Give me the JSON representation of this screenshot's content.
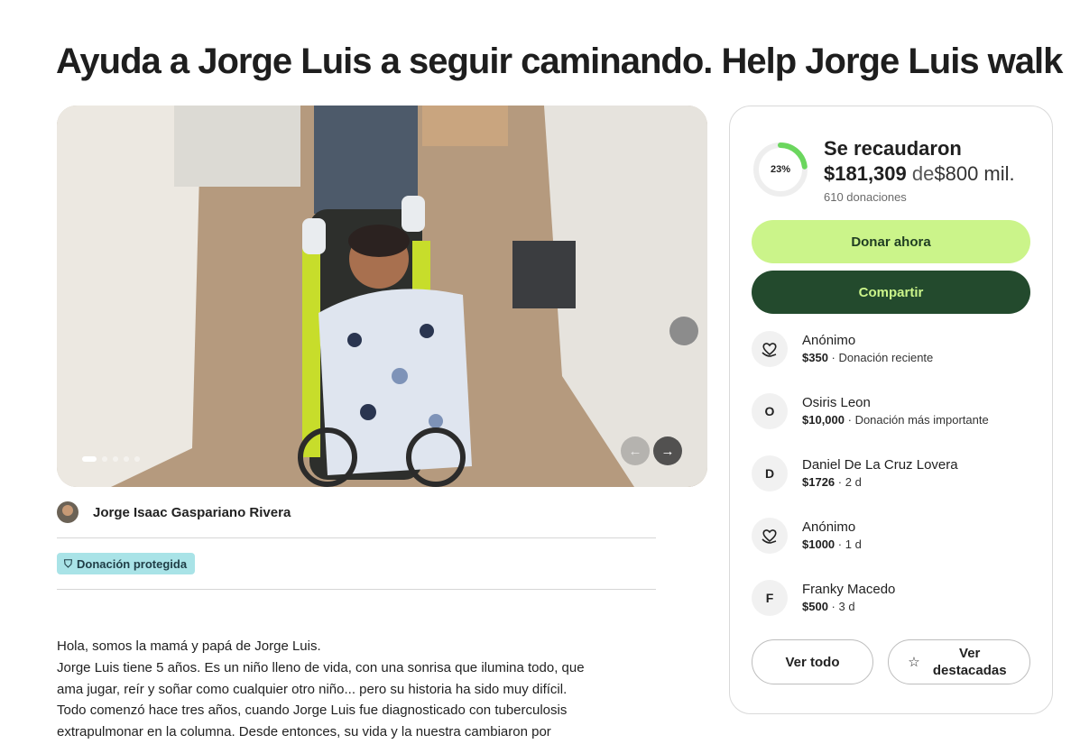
{
  "page": {
    "title": "Ayuda a Jorge Luis a seguir caminando. Help Jorge Luis walk"
  },
  "gallery": {
    "prev_icon": "←",
    "next_icon": "→",
    "slide_count": 5,
    "active_slide": 1
  },
  "organizer": {
    "name": "Jorge Isaac Gaspariano Rivera"
  },
  "badge": {
    "icon": "shield-icon",
    "label": "Donación protegida"
  },
  "story": {
    "lines": [
      "Hola, somos la mamá y papá de Jorge Luis.",
      "Jorge Luis tiene 5 años. Es un niño lleno de vida, con una sonrisa que ilumina todo, que",
      "ama jugar, reír y soñar como cualquier otro niño... pero su historia ha sido muy difícil.",
      "Todo comenzó hace tres años, cuando Jorge Luis fue diagnosticado con tuberculosis",
      "extrapulmonar en la columna. Desde entonces, su vida y la nuestra cambiaron por"
    ]
  },
  "summary": {
    "progress_percent": 23,
    "progress_label": "23%",
    "progress_color": "#6bd65e",
    "raised_label": "Se recaudaron",
    "raised_amount": "$181,309",
    "of_text": "de",
    "goal": "$800 mil.",
    "donation_count": "610 donaciones",
    "donate_label": "Donar ahora",
    "share_label": "Compartir"
  },
  "donors": [
    {
      "avatar": "heart-hand-icon",
      "name": "Anónimo",
      "amount": "$350",
      "detail": "· Donación reciente"
    },
    {
      "avatar": "O",
      "name": "Osiris Leon",
      "amount": "$10,000",
      "detail": "· Donación más importante"
    },
    {
      "avatar": "D",
      "name": "Daniel De La Cruz Lovera",
      "amount": "$1726",
      "detail": "· 2 d"
    },
    {
      "avatar": "heart-hand-icon",
      "name": "Anónimo",
      "amount": "$1000",
      "detail": "· 1 d"
    },
    {
      "avatar": "F",
      "name": "Franky Macedo",
      "amount": "$500",
      "detail": "· 3 d"
    }
  ],
  "actions": {
    "see_all": "Ver todo",
    "see_featured": "Ver destacadas",
    "featured_icon": "☆"
  },
  "colors": {
    "donate_bg": "#cbf48a",
    "share_bg": "#234a2d",
    "badge_bg": "#a9e3e7"
  }
}
